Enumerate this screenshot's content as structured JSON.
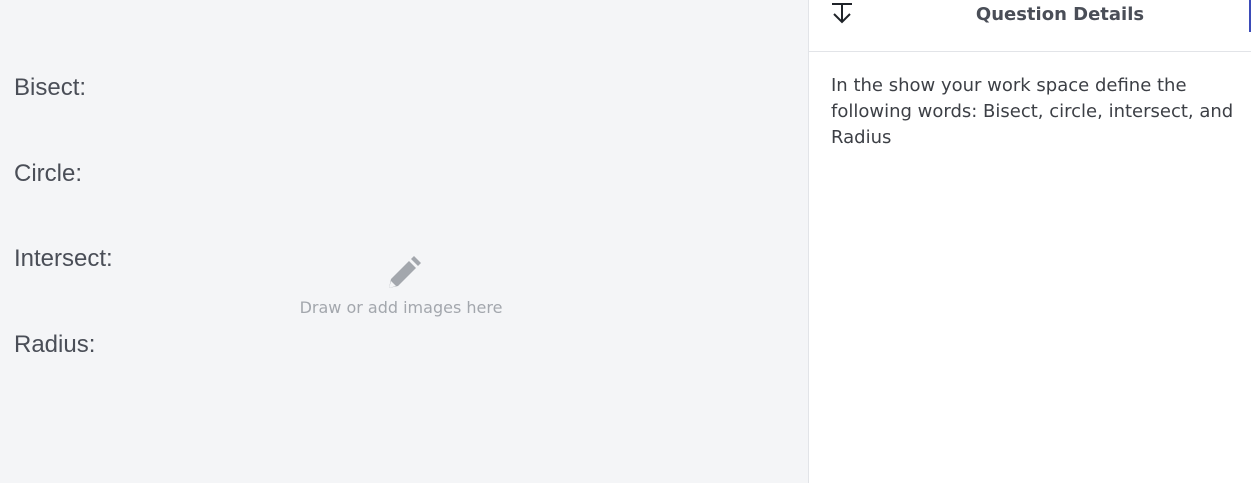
{
  "canvas": {
    "terms": [
      "Bisect:",
      "Circle:",
      "Intersect:",
      "Radius:"
    ],
    "placeholder_icon": "pencil-icon",
    "placeholder_text": "Draw or add images here"
  },
  "panel": {
    "collapse_icon": "collapse-down-icon",
    "title": "Question Details",
    "question": "In the show your work space define the following words: Bisect, circle, intersect, and Radius"
  },
  "colors": {
    "canvas_bg": "#f4f5f7",
    "accent": "#3b4bb8"
  }
}
